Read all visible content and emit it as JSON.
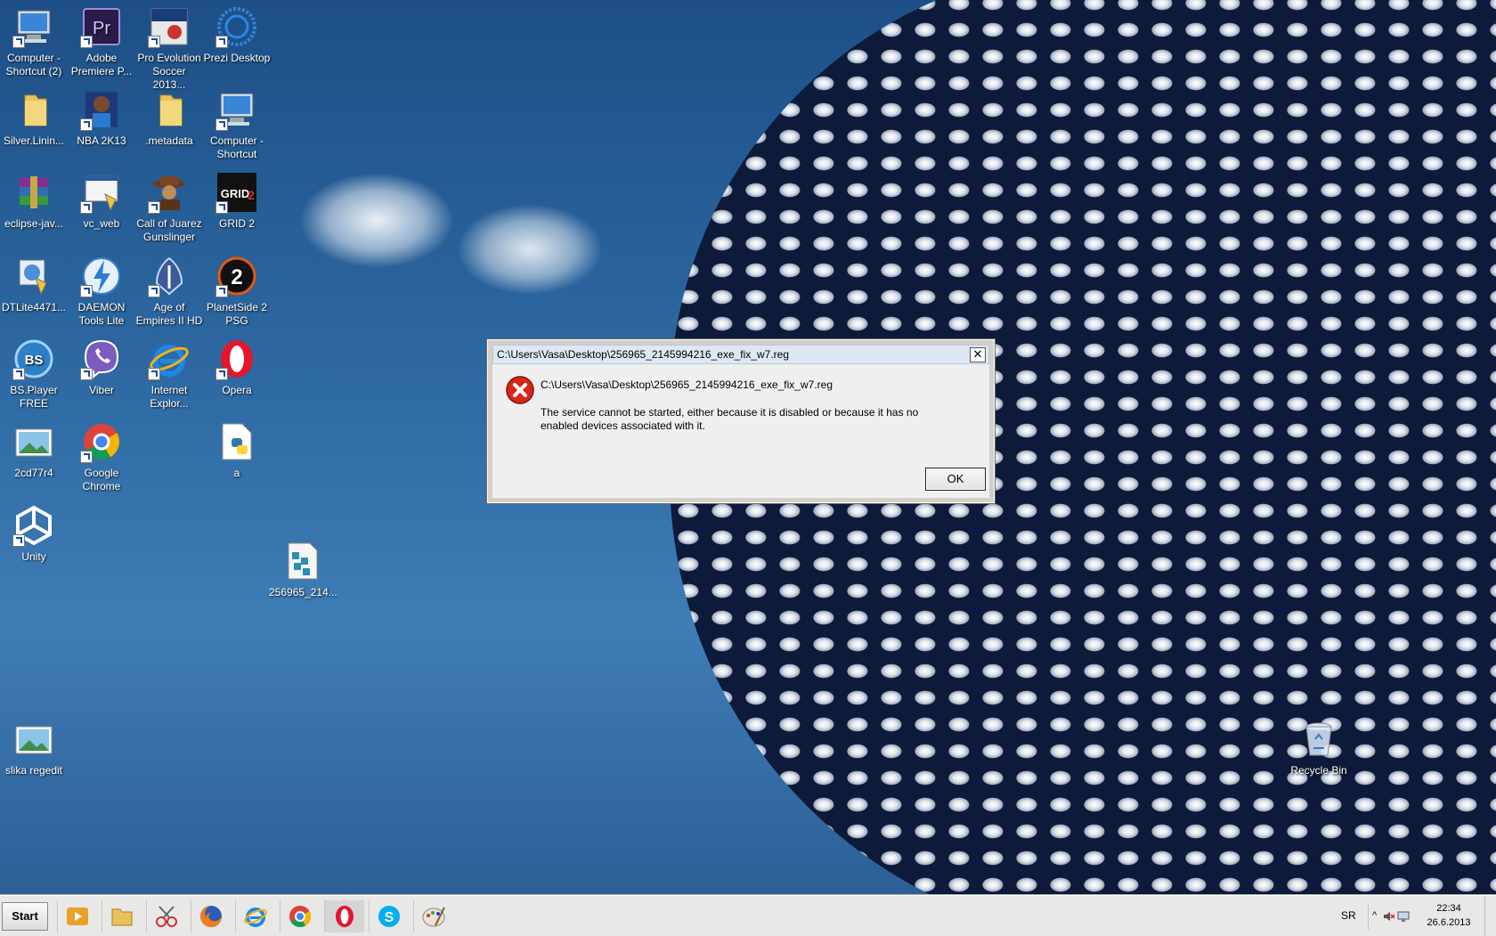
{
  "desktop": {
    "icons": [
      {
        "label": "Computer -\nShortcut (2)",
        "icon": "computer-icon"
      },
      {
        "label": "Adobe\nPremiere P...",
        "icon": "premiere-icon"
      },
      {
        "label": "Pro Evolution\nSoccer 2013...",
        "icon": "pes-icon"
      },
      {
        "label": "Prezi Desktop",
        "icon": "prezi-icon"
      },
      {
        "label": "Silver.Linin...",
        "icon": "folder-icon"
      },
      {
        "label": "NBA 2K13",
        "icon": "nba-icon"
      },
      {
        "label": ".metadata",
        "icon": "folder-icon"
      },
      {
        "label": "Computer -\nShortcut",
        "icon": "computer-icon"
      },
      {
        "label": "eclipse-jav...",
        "icon": "winrar-icon"
      },
      {
        "label": "vc_web",
        "icon": "installer-icon"
      },
      {
        "label": "Call of Juarez\nGunslinger",
        "icon": "game-icon"
      },
      {
        "label": "GRID 2",
        "icon": "grid-icon"
      },
      {
        "label": "DTLite4471...",
        "icon": "installer-icon"
      },
      {
        "label": "DAEMON\nTools Lite",
        "icon": "daemon-icon"
      },
      {
        "label": "Age of\nEmpires II HD",
        "icon": "aoe-icon"
      },
      {
        "label": "PlanetSide 2\nPSG",
        "icon": "planetside-icon"
      },
      {
        "label": "BS.Player\nFREE",
        "icon": "bsplayer-icon"
      },
      {
        "label": "Viber",
        "icon": "viber-icon"
      },
      {
        "label": "Internet\nExplor...",
        "icon": "ie-icon"
      },
      {
        "label": "Opera",
        "icon": "opera-icon"
      },
      {
        "label": "2cd77r4",
        "icon": "image-icon"
      },
      {
        "label": "Google\nChrome",
        "icon": "chrome-icon"
      },
      {
        "label": "a",
        "icon": "python-file-icon"
      },
      {
        "label": "Unity",
        "icon": "unity-icon"
      },
      {
        "label": "256965_214...",
        "icon": "registry-file-icon"
      },
      {
        "label": "slika regedit",
        "icon": "image-icon"
      },
      {
        "label": "Recycle Bin",
        "icon": "recycle-bin-icon"
      }
    ]
  },
  "dialog": {
    "title": "C:\\Users\\Vasa\\Desktop\\256965_2145994216_exe_fix_w7.reg",
    "close_label": "✕",
    "path": "C:\\Users\\Vasa\\Desktop\\256965_2145994216_exe_fix_w7.reg",
    "message": "The service cannot be started, either because it is disabled or because it has no enabled devices associated with it.",
    "ok_label": "OK"
  },
  "taskbar": {
    "start_label": "Start",
    "language": "SR",
    "time": "22:34",
    "date": "26.6.2013",
    "pinned": [
      "media-player-icon",
      "explorer-icon",
      "snipping-tool-icon",
      "firefox-icon",
      "ie-icon",
      "chrome-icon",
      "opera-icon",
      "skype-icon",
      "paint-icon"
    ]
  }
}
